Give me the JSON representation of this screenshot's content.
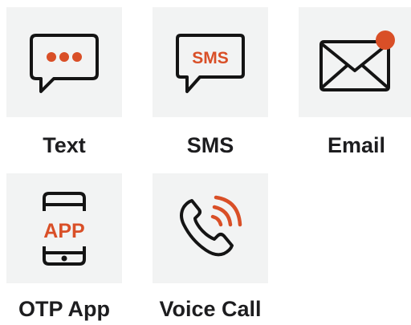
{
  "colors": {
    "accent": "#d94f27",
    "ink": "#141414",
    "tile_bg": "#f2f3f3"
  },
  "options": [
    {
      "label": "Text",
      "icon": "chat-bubble-dots-icon"
    },
    {
      "label": "SMS",
      "icon": "sms-bubble-icon",
      "icon_text": "SMS"
    },
    {
      "label": "Email",
      "icon": "envelope-notification-icon"
    },
    {
      "label": "OTP App",
      "icon": "phone-app-icon",
      "icon_text": "APP"
    },
    {
      "label": "Voice Call",
      "icon": "phone-ringing-icon"
    }
  ]
}
